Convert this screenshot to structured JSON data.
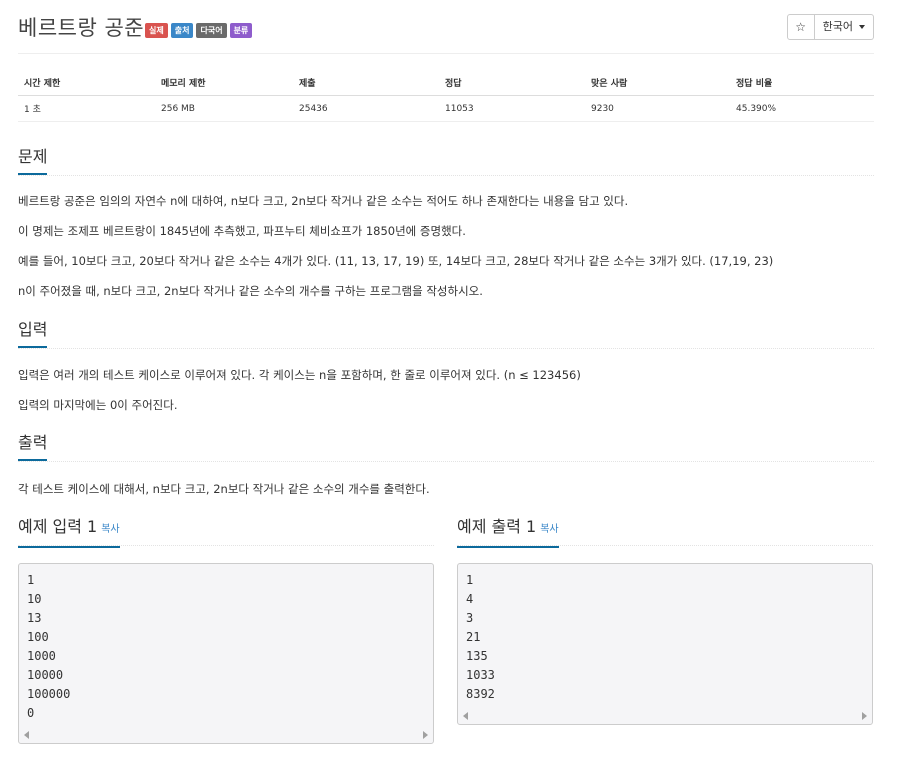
{
  "problem": {
    "title": "베르트랑 공준",
    "badges": [
      {
        "label": "실제",
        "color": "#d9534f"
      },
      {
        "label": "출처",
        "color": "#3a87c8"
      },
      {
        "label": "다국어",
        "color": "#6b6b6b"
      },
      {
        "label": "분류",
        "color": "#8e5ccc"
      }
    ],
    "star_label": "☆",
    "language": "한국어"
  },
  "stats": {
    "headers": [
      "시간 제한",
      "메모리 제한",
      "제출",
      "정답",
      "맞은 사람",
      "정답 비율"
    ],
    "values": [
      "1 초",
      "256 MB",
      "25436",
      "11053",
      "9230",
      "45.390%"
    ]
  },
  "sections": {
    "description": {
      "title": "문제",
      "paragraphs": [
        "베르트랑 공준은 임의의 자연수 n에 대하여, n보다 크고, 2n보다 작거나 같은 소수는 적어도 하나 존재한다는 내용을 담고 있다.",
        "이 명제는 조제프 베르트랑이 1845년에 추측했고, 파프누티 체비쇼프가 1850년에 증명했다.",
        "예를 들어, 10보다 크고, 20보다 작거나 같은 소수는 4개가 있다. (11, 13, 17, 19) 또, 14보다 크고, 28보다 작거나 같은 소수는 3개가 있다. (17,19, 23)",
        "n이 주어졌을 때, n보다 크고, 2n보다 작거나 같은 소수의 개수를 구하는 프로그램을 작성하시오."
      ]
    },
    "input": {
      "title": "입력",
      "paragraphs": [
        "입력은 여러 개의 테스트 케이스로 이루어져 있다. 각 케이스는 n을 포함하며, 한 줄로 이루어져 있다. (n ≤ 123456)",
        "입력의 마지막에는 0이 주어진다."
      ]
    },
    "output": {
      "title": "출력",
      "paragraphs": [
        "각 테스트 케이스에 대해서, n보다 크고, 2n보다 작거나 같은 소수의 개수를 출력한다."
      ]
    }
  },
  "samples": {
    "input": {
      "title": "예제 입력 1",
      "copy_label": "복사",
      "lines": [
        "1",
        "10",
        "13",
        "100",
        "1000",
        "10000",
        "100000",
        "0"
      ]
    },
    "output": {
      "title": "예제 출력 1",
      "copy_label": "복사",
      "lines": [
        "1",
        "4",
        "3",
        "21",
        "135",
        "1033",
        "8392"
      ]
    }
  }
}
